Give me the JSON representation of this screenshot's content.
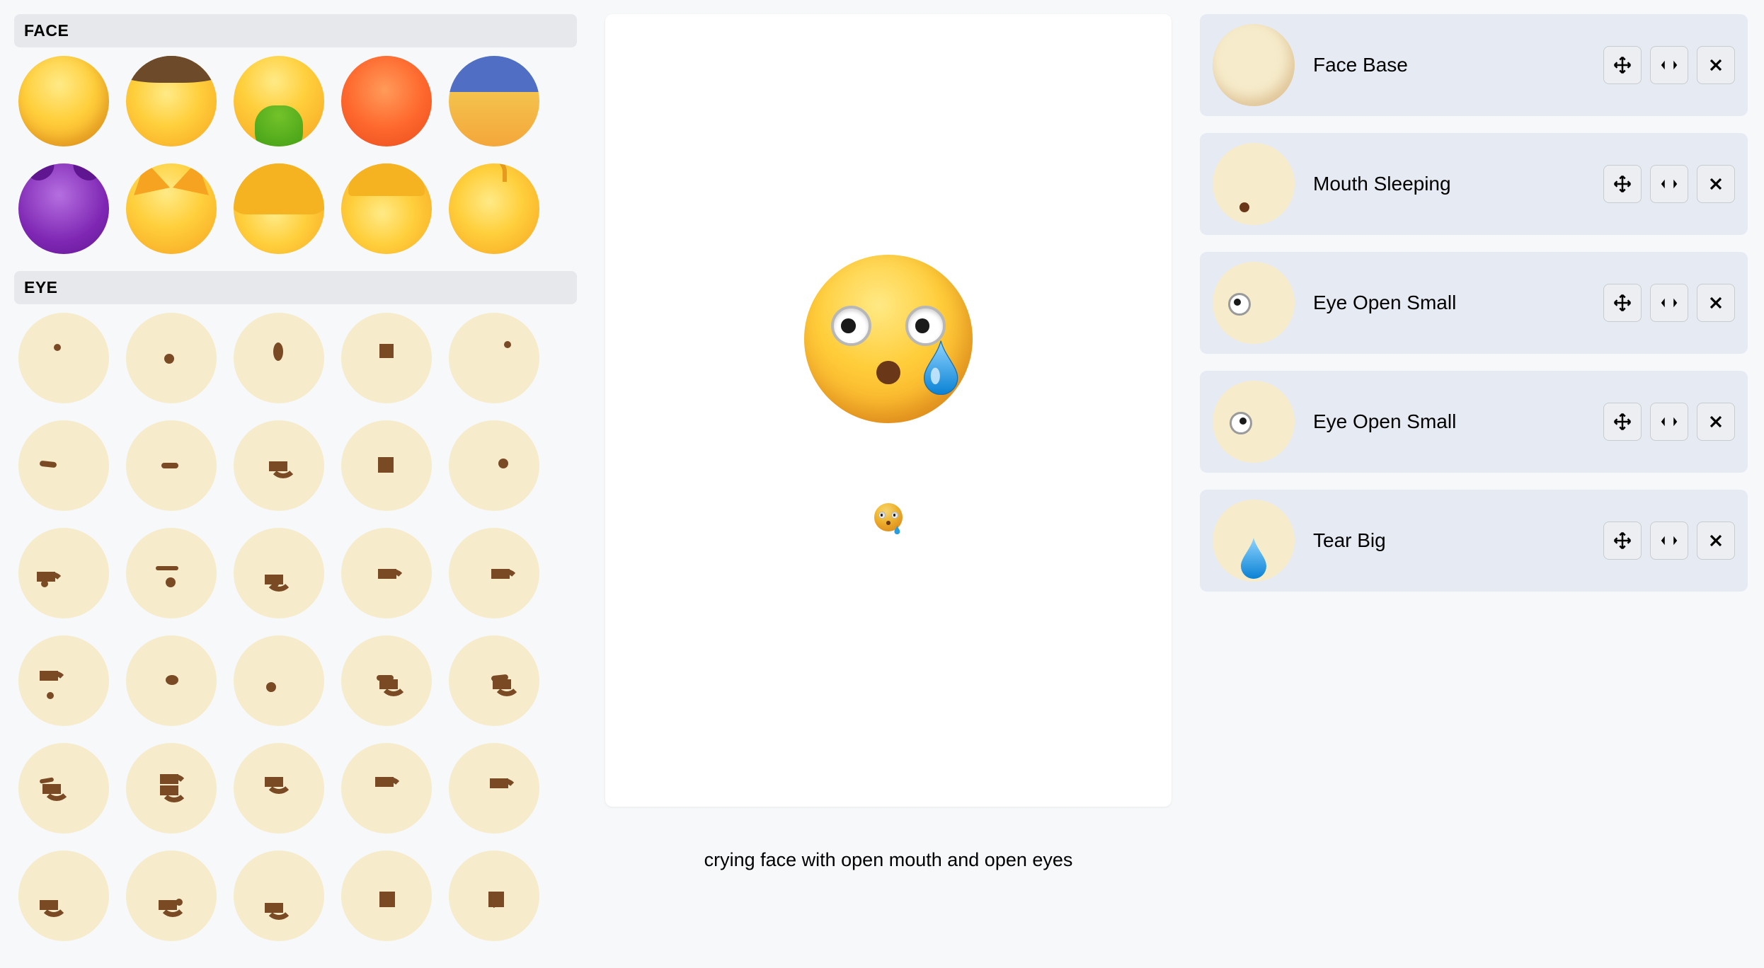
{
  "sections": {
    "face": "FACE",
    "eye": "EYE"
  },
  "caption": "crying face with open mouth and open eyes",
  "layers": [
    {
      "label": "Face Base",
      "thumb": "face-base"
    },
    {
      "label": "Mouth Sleeping",
      "thumb": "mouth"
    },
    {
      "label": "Eye Open Small",
      "thumb": "eye-small-l"
    },
    {
      "label": "Eye Open Small",
      "thumb": "eye-small-r"
    },
    {
      "label": "Tear Big",
      "thumb": "tear"
    }
  ],
  "icons": {
    "move": "move-icon",
    "swap": "swap-icon",
    "close": "close-icon"
  },
  "face_thumbs": [
    "face-base",
    "face-cowboy",
    "face-vomit",
    "face-red",
    "face-sunset",
    "face-purple",
    "face-cat",
    "face-person1",
    "face-person2",
    "face-baby"
  ],
  "eye_thumbs_rows": 6,
  "eye_thumbs_cols": 5
}
